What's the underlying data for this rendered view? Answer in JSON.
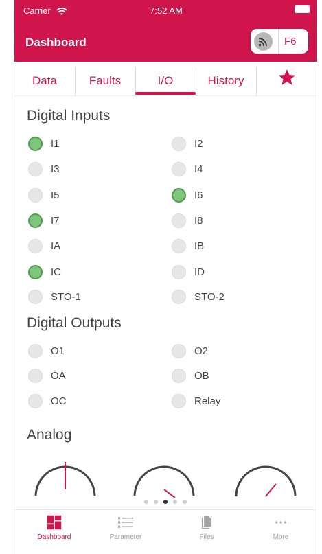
{
  "status_bar": {
    "carrier": "Carrier",
    "time": "7:52 AM"
  },
  "header": {
    "title": "Dashboard",
    "drive_id": "F6"
  },
  "tabs": [
    {
      "label": "Data"
    },
    {
      "label": "Faults"
    },
    {
      "label": "I/O",
      "active": true
    },
    {
      "label": "History"
    }
  ],
  "digital_inputs": {
    "title": "Digital Inputs",
    "items": [
      {
        "label": "I1",
        "on": true
      },
      {
        "label": "I2",
        "on": false
      },
      {
        "label": "I3",
        "on": false
      },
      {
        "label": "I4",
        "on": false
      },
      {
        "label": "I5",
        "on": false
      },
      {
        "label": "I6",
        "on": true
      },
      {
        "label": "I7",
        "on": true
      },
      {
        "label": "I8",
        "on": false
      },
      {
        "label": "IA",
        "on": false
      },
      {
        "label": "IB",
        "on": false
      },
      {
        "label": "IC",
        "on": true
      },
      {
        "label": "ID",
        "on": false
      },
      {
        "label": "STO-1",
        "on": false
      },
      {
        "label": "STO-2",
        "on": false
      }
    ]
  },
  "digital_outputs": {
    "title": "Digital Outputs",
    "items": [
      {
        "label": "O1",
        "on": false
      },
      {
        "label": "O2",
        "on": false
      },
      {
        "label": "OA",
        "on": false
      },
      {
        "label": "OB",
        "on": false
      },
      {
        "label": "OC",
        "on": false
      },
      {
        "label": "Relay",
        "on": false
      }
    ]
  },
  "analog": {
    "title": "Analog"
  },
  "pager": {
    "current_page": 3,
    "page_count": 5
  },
  "tabbar": [
    {
      "label": "Dashboard",
      "icon": "dashboard-icon",
      "active": true
    },
    {
      "label": "Parameter",
      "icon": "list-icon"
    },
    {
      "label": "Files",
      "icon": "files-icon"
    },
    {
      "label": "More",
      "icon": "more-icon"
    }
  ],
  "colors": {
    "accent": "#d0154d",
    "led_on": "#7fc57c",
    "led_off": "#e7e7e7"
  }
}
